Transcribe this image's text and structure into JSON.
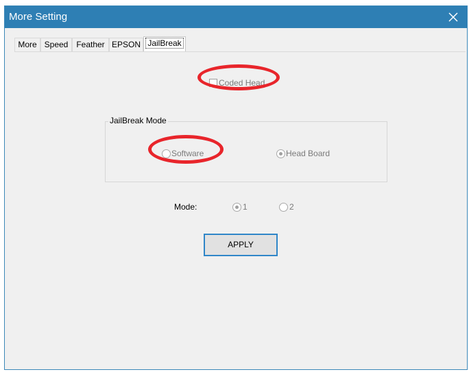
{
  "window": {
    "title": "More Setting",
    "close_icon": "close-icon"
  },
  "tabs": [
    {
      "label": "More",
      "active": false
    },
    {
      "label": "Speed",
      "active": false
    },
    {
      "label": "Feather",
      "active": false
    },
    {
      "label": "EPSON",
      "active": false
    },
    {
      "label": "JailBreak",
      "active": true
    }
  ],
  "jailbreak": {
    "coded_head": {
      "label": "Coded Head",
      "checked": false,
      "enabled": false
    },
    "mode_group": {
      "title": "JailBreak Mode",
      "options": [
        {
          "label": "Software",
          "selected": false,
          "enabled": false
        },
        {
          "label": "Head Board",
          "selected": true,
          "enabled": false
        }
      ]
    },
    "mode": {
      "label": "Mode:",
      "options": [
        {
          "label": "1",
          "selected": true,
          "enabled": false
        },
        {
          "label": "2",
          "selected": false,
          "enabled": false
        }
      ]
    },
    "apply_label": "APPLY"
  },
  "annotations": {
    "highlight_color": "#e8252b"
  }
}
